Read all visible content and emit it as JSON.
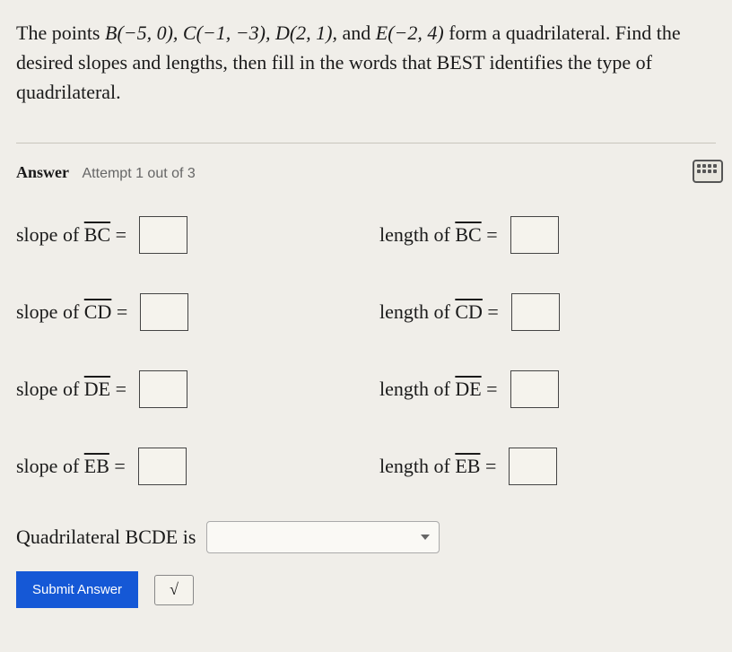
{
  "question": {
    "prefix": "The points ",
    "pts": "B(−5, 0), C(−1, −3), D(2, 1),",
    "and": " and ",
    "ptE": "E(−2, 4)",
    "suffix": " form a quadrilateral. Find the desired slopes and lengths, then fill in the words that BEST identifies the type of quadrilateral."
  },
  "answer_label": "Answer",
  "attempt_label": "Attempt 1 out of 3",
  "rows": [
    {
      "slope_prefix": "slope of ",
      "seg": "BC",
      "eq": " = ",
      "length_prefix": "length of "
    },
    {
      "slope_prefix": "slope of ",
      "seg": "CD",
      "eq": " = ",
      "length_prefix": "length of "
    },
    {
      "slope_prefix": "slope of ",
      "seg": "DE",
      "eq": " = ",
      "length_prefix": "length of "
    },
    {
      "slope_prefix": "slope of ",
      "seg": "EB",
      "eq": " = ",
      "length_prefix": "length of "
    }
  ],
  "conclusion_label": "Quadrilateral BCDE is",
  "submit_label": "Submit Answer",
  "sqrt_symbol": "√"
}
